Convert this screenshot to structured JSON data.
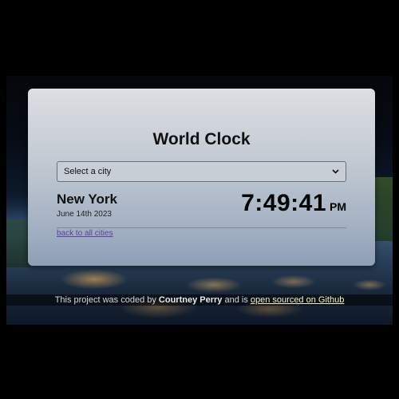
{
  "app": {
    "title": "World Clock"
  },
  "selector": {
    "selected": "Select a city",
    "icon": "chevron-down-icon"
  },
  "city": {
    "name": "New York",
    "date": "June 14th 2023",
    "time": "7:49:41",
    "ampm": "PM"
  },
  "links": {
    "back": "back to all cities"
  },
  "footer": {
    "prefix": "This project was coded by",
    "author": "Courtney Perry",
    "middle": "and is",
    "link_text": "open sourced on Github"
  },
  "colors": {
    "link": "#5a3fa0",
    "footer_link": "#f4f0c8"
  }
}
